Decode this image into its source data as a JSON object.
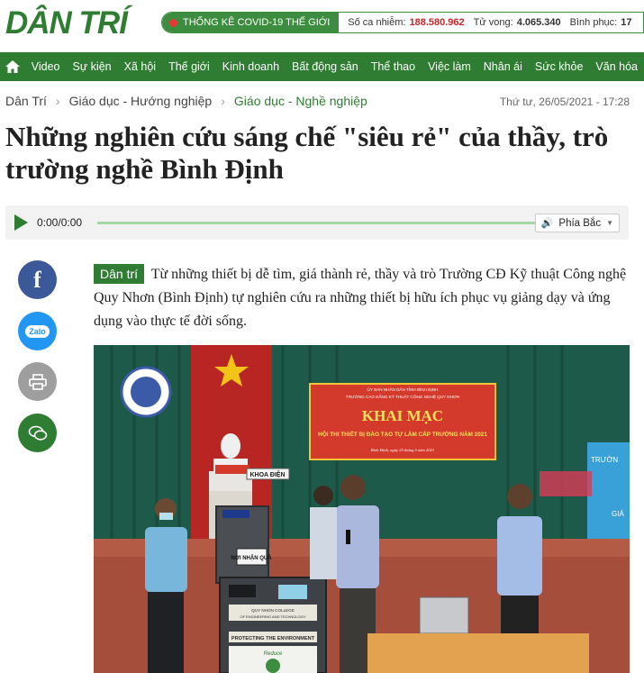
{
  "header": {
    "logo_text": "DÂN TRÍ",
    "covid_label": "THỐNG KÊ COVID-19 THẾ GIỚI",
    "stats": [
      {
        "label": "Số ca nhiễm:",
        "value": "188.580.962",
        "accent": "#c62828"
      },
      {
        "label": "Tử vong:",
        "value": "4.065.340",
        "accent": "#222222"
      },
      {
        "label": "Bình phục:",
        "value": "17",
        "accent": "#222222"
      }
    ]
  },
  "nav": {
    "home_icon": "home-icon",
    "items": [
      "Video",
      "Sự kiện",
      "Xã hội",
      "Thế giới",
      "Kinh doanh",
      "Bất động sản",
      "Thể thao",
      "Việc làm",
      "Nhân ái",
      "Sức khỏe",
      "Văn hóa"
    ]
  },
  "breadcrumb": {
    "items": [
      "Dân Trí",
      "Giáo dục - Hướng nghiệp",
      "Giáo dục - Nghề nghiệp"
    ]
  },
  "date": "Thứ tư, 26/05/2021 - 17:28",
  "article": {
    "title": "Những nghiên cứu sáng chế \"siêu rẻ\" của thầy, trò trường nghề Bình Định",
    "brand_tag": "Dân trí",
    "lead": "Từ những thiết bị dễ tìm, giá thành rẻ, thầy và trò Trường CĐ Kỹ thuật Công nghệ Quy Nhơn (Bình Định) tự nghiên cứu ra những thiết bị hữu ích phục vụ giảng dạy và ứng dụng vào thực tế đời sống."
  },
  "audio": {
    "time": "0:00/0:00",
    "voice": "Phía Bắc"
  },
  "share": {
    "facebook_glyph": "f",
    "zalo_text": "Zalo"
  },
  "photo": {
    "banner_top1": "ỦY BAN NHÂN DÂN TỈNH BÌNH ĐỊNH",
    "banner_top2": "TRƯỜNG CAO ĐẲNG KỸ THUẬT CÔNG NGHỆ QUY NHƠN",
    "banner_main": "KHAI MẠC",
    "banner_sub": "HỘI THI THIẾT BỊ ĐÀO TẠO TỰ LÀM CẤP TRƯỜNG NĂM 2021",
    "banner_place": "Bình Định, ngày 25 tháng 5 năm 2021",
    "podium_sign": "KHOA ĐIỆN",
    "machine_label": "NƠI NHẬN QUÀ",
    "machine_college1": "QUY NHON COLLEGE",
    "machine_college2": "OF ENGINEERING AND TECHNOLOGY",
    "machine_env": "PROTECTING THE ENVIRONMENT",
    "machine_reduce": "Reduce",
    "screen_text1": "TRƯỜN",
    "screen_text2": "GIÁ"
  },
  "colors": {
    "brand": "#2f7d32",
    "alert": "#c62828",
    "facebook": "#3b5998",
    "zalo": "#2196f3",
    "print": "#9e9e9e"
  }
}
